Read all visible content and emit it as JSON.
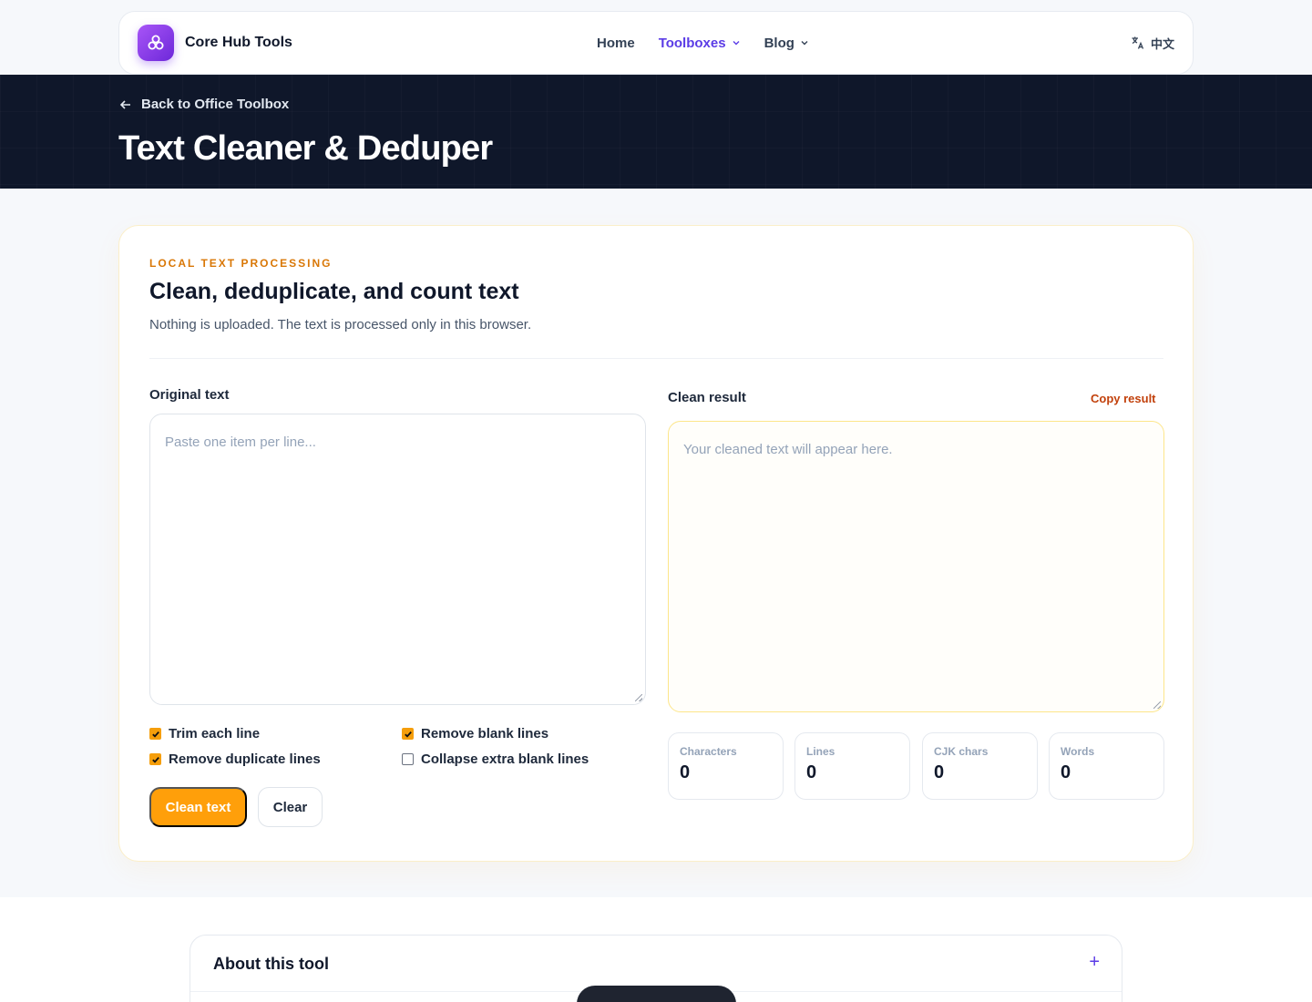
{
  "nav": {
    "brand": "Core Hub Tools",
    "links": [
      {
        "label": "Home"
      },
      {
        "label": "Toolboxes"
      },
      {
        "label": "Blog"
      }
    ],
    "language": "中文"
  },
  "hero": {
    "back_label": "Back to Office Toolbox",
    "title": "Text Cleaner & Deduper"
  },
  "card": {
    "eyebrow": "LOCAL TEXT PROCESSING",
    "title": "Clean, deduplicate, and count text",
    "subtitle": "Nothing is uploaded. The text is processed only in this browser.",
    "input": {
      "label": "Original text",
      "value": "",
      "placeholder": "Paste one item per line..."
    },
    "output": {
      "label": "Clean result",
      "copy_label": "Copy result",
      "value": "",
      "placeholder": "Your cleaned text will appear here."
    },
    "options": [
      {
        "label": "Trim each line",
        "checked": true
      },
      {
        "label": "Remove blank lines",
        "checked": true
      },
      {
        "label": "Remove duplicate lines",
        "checked": true
      },
      {
        "label": "Collapse extra blank lines",
        "checked": false
      }
    ],
    "buttons": {
      "primary": "Clean text",
      "secondary": "Clear"
    },
    "stats": [
      {
        "label": "Characters",
        "value": "0"
      },
      {
        "label": "Lines",
        "value": "0"
      },
      {
        "label": "CJK chars",
        "value": "0"
      },
      {
        "label": "Words",
        "value": "0"
      }
    ]
  },
  "about": {
    "title": "About this tool",
    "toggle": "+"
  },
  "colors": {
    "accent": "#ff9f0a",
    "brand": "#7c3aed",
    "nav_active": "#5b3ce6",
    "hero_bg": "#0f172a"
  }
}
